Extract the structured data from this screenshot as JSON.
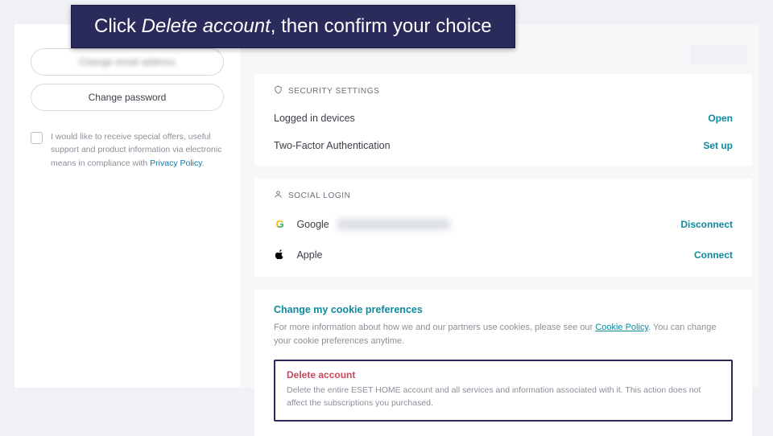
{
  "overlay": {
    "pre": "Click ",
    "em": "Delete account",
    "post": ", then confirm your choice"
  },
  "left": {
    "btn1": "Change email address",
    "btn2": "Change password",
    "consent": {
      "text_a": "I would like to receive special offers, useful support and product information via electronic means in compliance with ",
      "link": "Privacy Policy",
      "text_b": "."
    }
  },
  "security": {
    "header": "SECURITY SETTINGS",
    "row1": {
      "label": "Logged in devices",
      "action": "Open"
    },
    "row2": {
      "label": "Two-Factor Authentication",
      "action": "Set up"
    }
  },
  "social": {
    "header": "SOCIAL LOGIN",
    "google": {
      "label": "Google",
      "action": "Disconnect"
    },
    "apple": {
      "label": "Apple",
      "action": "Connect"
    }
  },
  "cookies": {
    "link": "Change my cookie preferences",
    "desc_a": "For more information about how we and our partners use cookies, please see our ",
    "policy": "Cookie Policy",
    "desc_b": ". You can change your cookie preferences anytime."
  },
  "del": {
    "title": "Delete account",
    "desc": "Delete the entire ESET HOME account and all services and information associated with it. This action does not affect the subscriptions you purchased."
  }
}
